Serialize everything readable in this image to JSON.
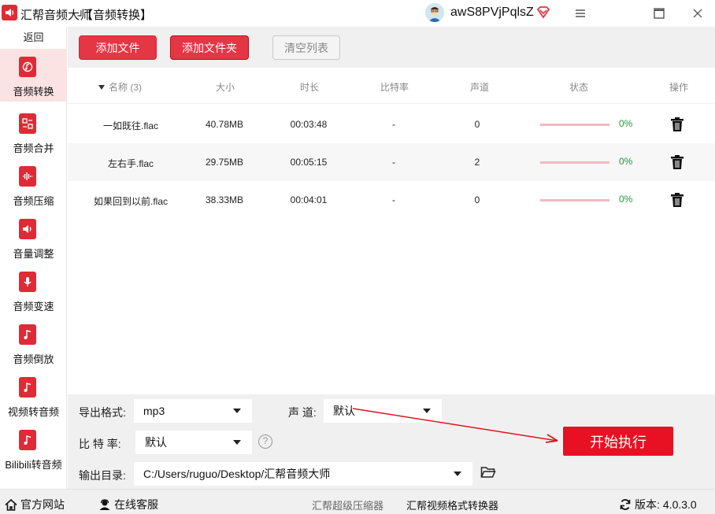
{
  "titlebar": {
    "app_name": "汇帮音频大师",
    "page_name": "-【音频转换】",
    "username": "awS8PVjPqlsZ",
    "icons": [
      "app-logo-icon",
      "avatar-icon",
      "vip-diamond-icon",
      "menu-icon",
      "maximize-icon",
      "close-icon"
    ]
  },
  "sidebar": {
    "back_label": "返回",
    "items": [
      {
        "label": "音频转换",
        "icon": "audio-convert-icon",
        "active": true
      },
      {
        "label": "音频合并",
        "icon": "audio-merge-icon",
        "active": false
      },
      {
        "label": "音频压缩",
        "icon": "audio-compress-icon",
        "active": false
      },
      {
        "label": "音量调整",
        "icon": "volume-adjust-icon",
        "active": false
      },
      {
        "label": "音频变速",
        "icon": "audio-speed-icon",
        "active": false
      },
      {
        "label": "音频倒放",
        "icon": "audio-reverse-icon",
        "active": false
      },
      {
        "label": "视频转音频",
        "icon": "video-to-audio-icon",
        "active": false
      },
      {
        "label": "Bilibili转音频",
        "icon": "bilibili-to-audio-icon",
        "active": false
      }
    ]
  },
  "toolbar": {
    "add_file_label": "添加文件",
    "add_folder_label": "添加文件夹",
    "clear_list_label": "清空列表"
  },
  "table": {
    "headers": {
      "name": "名称 (3)",
      "size": "大小",
      "duration": "时长",
      "bitrate": "比特率",
      "channels": "声道",
      "status": "状态",
      "action": "操作"
    },
    "rows": [
      {
        "name": "一如既往.flac",
        "size": "40.78MB",
        "duration": "00:03:48",
        "bitrate": "-",
        "channels": "0",
        "progress": "0%"
      },
      {
        "name": "左右手.flac",
        "size": "29.75MB",
        "duration": "00:05:15",
        "bitrate": "-",
        "channels": "2",
        "progress": "0%"
      },
      {
        "name": "如果回到以前.flac",
        "size": "38.33MB",
        "duration": "00:04:01",
        "bitrate": "-",
        "channels": "0",
        "progress": "0%"
      }
    ]
  },
  "settings": {
    "format_label": "导出格式:",
    "format_value": "mp3",
    "channel_label": "声 道:",
    "channel_value": "默认",
    "bitrate_label": "比 特 率:",
    "bitrate_value": "默认",
    "help_symbol": "?",
    "output_label": "输出目录:",
    "output_value": "C:/Users/ruguo/Desktop/汇帮音频大师",
    "start_label": "开始执行"
  },
  "statusbar": {
    "website_label": "官方网站",
    "support_label": "在线客服",
    "link1_label": "汇帮超级压缩器",
    "link2_label": "汇帮视频格式转换器",
    "version_label": "版本:",
    "version_value": "4.0.3.0"
  },
  "colors": {
    "accent": "#e53645",
    "start_button": "#e81123",
    "progress_track": "#f3b9c1",
    "progress_text": "#1f9a36",
    "sidebar_active": "#fbe2e3"
  }
}
